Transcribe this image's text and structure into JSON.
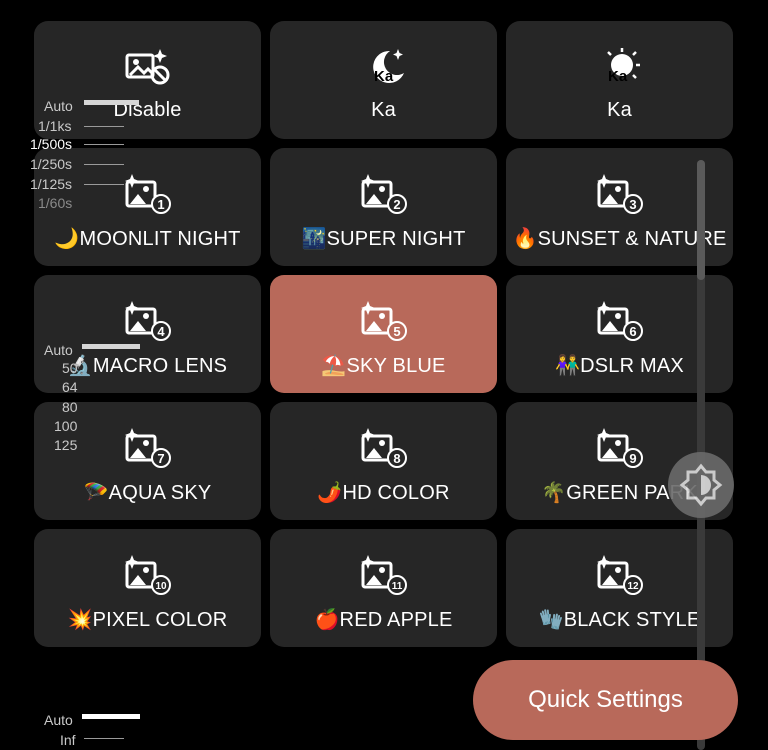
{
  "tiles": [
    {
      "label": "Disable",
      "icon": "image-disable-icon",
      "active": false
    },
    {
      "label": "Ka",
      "icon": "moon-ka-icon",
      "active": false
    },
    {
      "label": "Ka",
      "icon": "sun-ka-icon",
      "active": false
    },
    {
      "label": "🌙MOONLIT NIGHT",
      "icon": "preset-1-icon",
      "num": "1",
      "active": false
    },
    {
      "label": "🌃SUPER NIGHT",
      "icon": "preset-2-icon",
      "num": "2",
      "active": false
    },
    {
      "label": "🔥SUNSET & NATURE",
      "icon": "preset-3-icon",
      "num": "3",
      "active": false
    },
    {
      "label": "🔬MACRO LENS",
      "icon": "preset-4-icon",
      "num": "4",
      "active": false
    },
    {
      "label": "⛱️SKY BLUE",
      "icon": "preset-5-icon",
      "num": "5",
      "active": true
    },
    {
      "label": "👫DSLR MAX",
      "icon": "preset-6-icon",
      "num": "6",
      "active": false
    },
    {
      "label": "🪂AQUA SKY",
      "icon": "preset-7-icon",
      "num": "7",
      "active": false
    },
    {
      "label": "🌶️HD COLOR",
      "icon": "preset-8-icon",
      "num": "8",
      "active": false
    },
    {
      "label": "🌴GREEN PARK",
      "icon": "preset-9-icon",
      "num": "9",
      "active": false
    },
    {
      "label": "💥PIXEL COLOR",
      "icon": "preset-10-icon",
      "num": "10",
      "active": false
    },
    {
      "label": "🍎RED APPLE",
      "icon": "preset-11-icon",
      "num": "11",
      "active": false
    },
    {
      "label": "🧤BLACK STYLE",
      "icon": "preset-12-icon",
      "num": "12",
      "active": false
    }
  ],
  "shutter": {
    "auto": "Auto",
    "values": [
      "1/1ks",
      "1/500s",
      "1/250s",
      "1/125s",
      "1/60s"
    ]
  },
  "iso": {
    "auto": "Auto",
    "values": [
      "50",
      "64",
      "80",
      "100",
      "125"
    ]
  },
  "focus": {
    "auto": "Auto",
    "value": "Inf"
  },
  "quick_settings_label": "Quick Settings",
  "colors": {
    "tile": "#262626",
    "active": "#b8695a",
    "background": "#000000"
  }
}
